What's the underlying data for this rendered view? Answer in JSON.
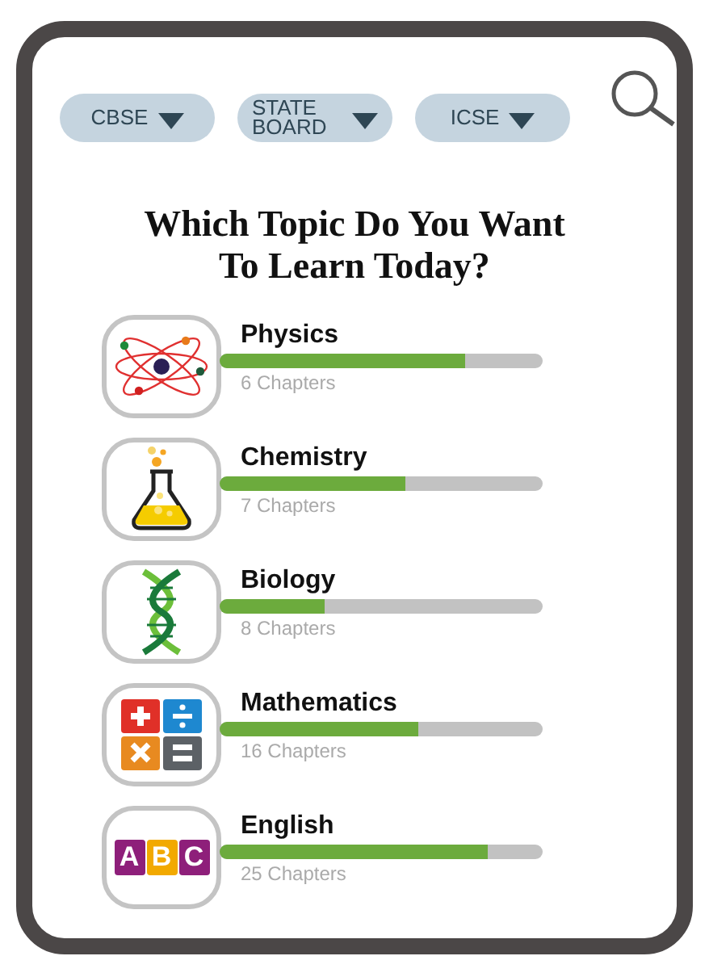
{
  "filters": [
    {
      "label": "CBSE"
    },
    {
      "label": "STATE BOARD"
    },
    {
      "label": "ICSE"
    }
  ],
  "title": "Which Topic Do You Want To Learn Today?",
  "topics": [
    {
      "name": "Physics",
      "level": 0.76,
      "chapters": "6 Chapters"
    },
    {
      "name": "Chemistry",
      "level": 0.575,
      "chapters": "7 Chapters"
    },
    {
      "name": "Biology",
      "level": 0.325,
      "chapters": "8 Chapters"
    },
    {
      "name": "Mathematics",
      "level": 0.615,
      "chapters": "16 Chapters"
    },
    {
      "name": "English",
      "level": 0.83,
      "chapters": "25 Chapters",
      "icon_text": [
        "A",
        "B",
        "C"
      ]
    }
  ]
}
